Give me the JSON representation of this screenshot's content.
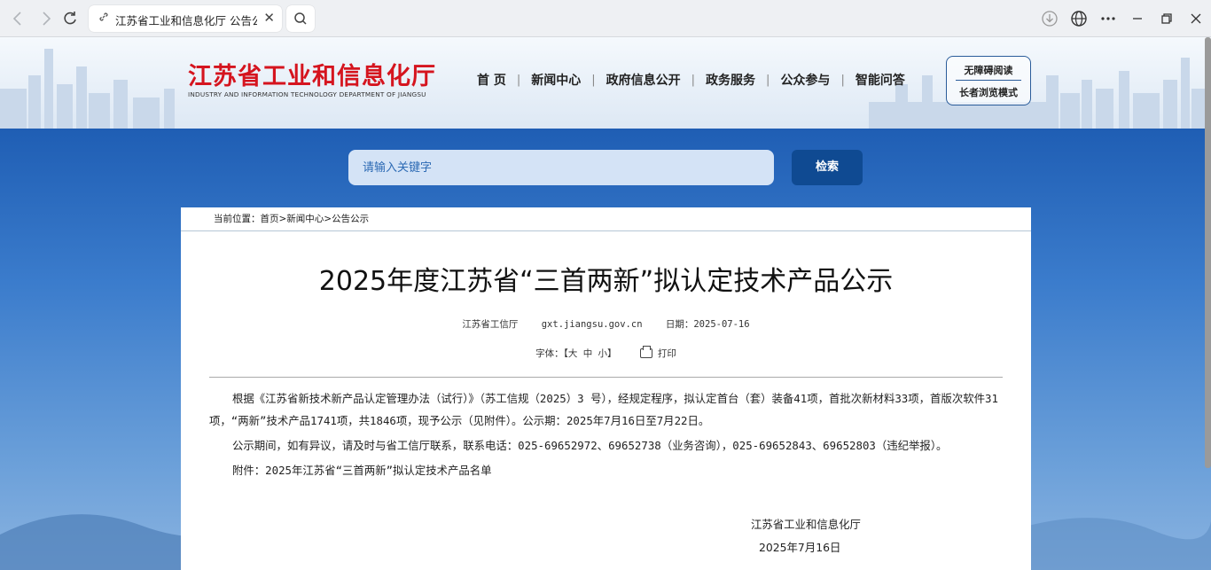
{
  "browser": {
    "tab_title": "江苏省工业和信息化厅 公告公示",
    "back_icon": "chevron-left-icon",
    "forward_icon": "chevron-right-icon",
    "reload_icon": "reload-icon",
    "close_glyph": "✕"
  },
  "header": {
    "logo_title": "江苏省工业和信息化厅",
    "logo_subtitle": "INDUSTRY AND INFORMATION TECHNOLOGY DEPARTMENT OF JIANGSU",
    "nav": [
      "首 页",
      "新闻中心",
      "政府信息公开",
      "政务服务",
      "公众参与",
      "智能问答"
    ],
    "nav_separator": "|",
    "accessibility": "无障碍阅读",
    "elder_mode": "长者浏览模式"
  },
  "search": {
    "placeholder": "请输入关键字",
    "button": "检索"
  },
  "breadcrumb": {
    "label": "当前位置：",
    "path": "首页>新闻中心>公告公示"
  },
  "article": {
    "title": "2025年度江苏省“三首两新”拟认定技术产品公示",
    "source": "江苏省工信厅",
    "site": "gxt.jiangsu.gov.cn",
    "date": "日期：2025-07-16",
    "font_size_label": "字体：【大 中 小】",
    "print_label": "打印",
    "paragraphs": [
      "根据《江苏省新技术新产品认定管理办法（试行）》（苏工信规（2025）3 号），经规定程序，拟认定首台（套）装备41项，首批次新材料33项，首版次软件31项，“两新”技术产品1741项，共1846项，现予公示（见附件）。公示期：2025年7月16日至7月22日。",
      "公示期间，如有异议，请及时与省工信厅联系，联系电话：025-69652972、69652738（业务咨询），025-69652843、69652803（违纪举报）。",
      "附件：2025年江苏省“三首两新”拟认定技术产品名单"
    ],
    "signature": "江苏省工业和信息化厅",
    "signature_date": "2025年7月16日"
  },
  "colors": {
    "brand_red": "#d5141e",
    "brand_blue": "#0f4a92"
  }
}
